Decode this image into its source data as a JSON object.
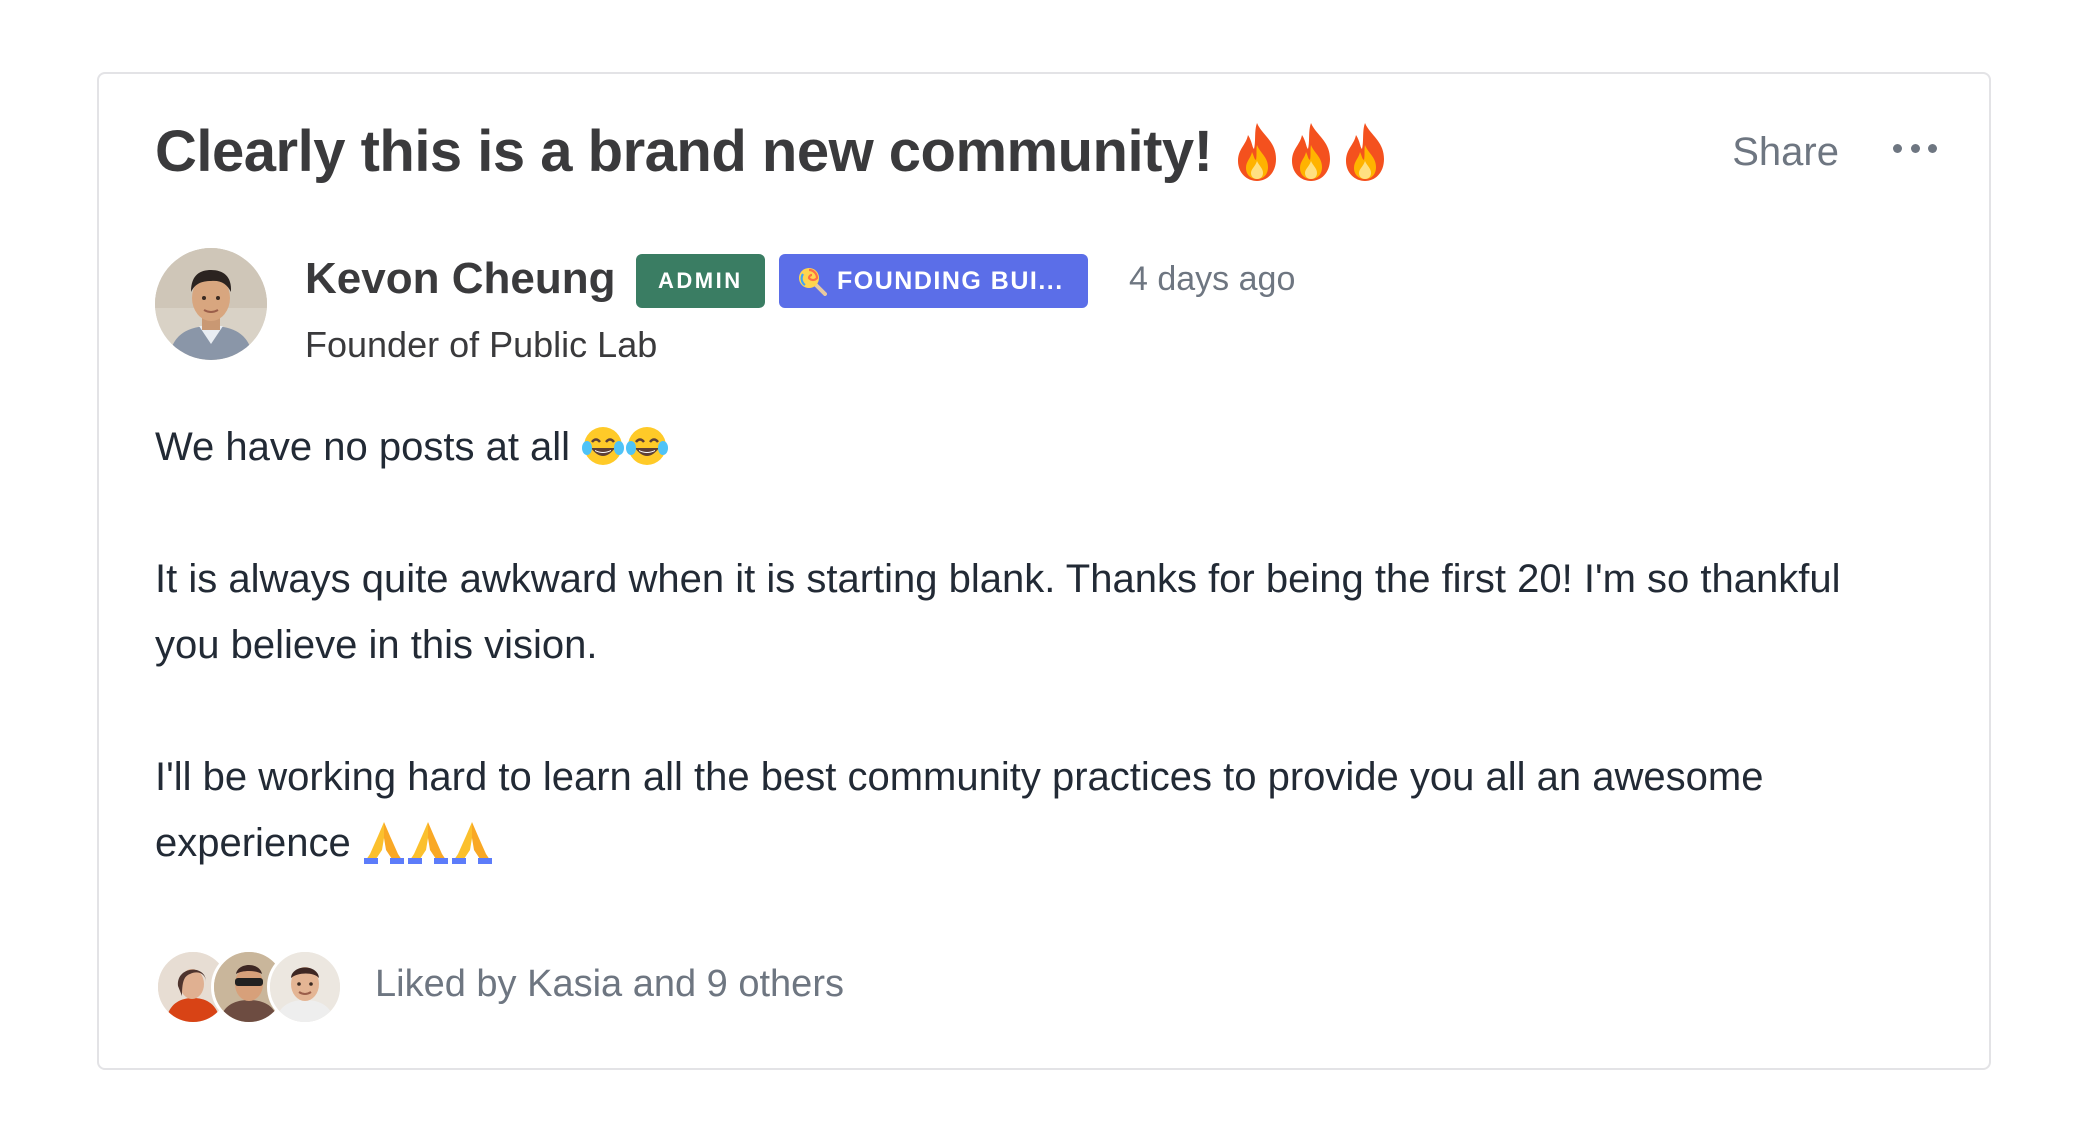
{
  "post": {
    "title": "Clearly this is a brand new community!",
    "title_emoji": [
      "fire-emoji",
      "fire-emoji",
      "fire-emoji"
    ],
    "share_label": "Share",
    "more_icon": "ellipsis-icon"
  },
  "author": {
    "name": "Kevon Cheung",
    "role": "Founder of Public Lab",
    "badges": [
      {
        "label": "ADMIN",
        "color": "#3a7d63"
      },
      {
        "label": "FOUNDING BUI...",
        "color": "#5b6ee8",
        "icon": "lollipop-icon"
      }
    ],
    "timestamp": "4 days ago"
  },
  "body": {
    "paragraphs": [
      "We have no posts at all",
      "It is always quite awkward when it is starting blank. Thanks for being the first 20! I'm so thankful you believe in this vision.",
      "I'll be working hard to learn all the best community practices to provide you all an awesome experience"
    ],
    "paragraph_emoji": [
      [
        "laughing-tears-emoji",
        "laughing-tears-emoji"
      ],
      [],
      [
        "praying-hands-emoji",
        "praying-hands-emoji",
        "praying-hands-emoji"
      ]
    ]
  },
  "likes": {
    "text": "Liked by Kasia and 9 others",
    "avatar_count": 3
  },
  "colors": {
    "accent_admin": "#3a7d63",
    "accent_founding": "#5b6ee8",
    "muted_text": "#6e7681",
    "border": "#e3e3e6"
  }
}
